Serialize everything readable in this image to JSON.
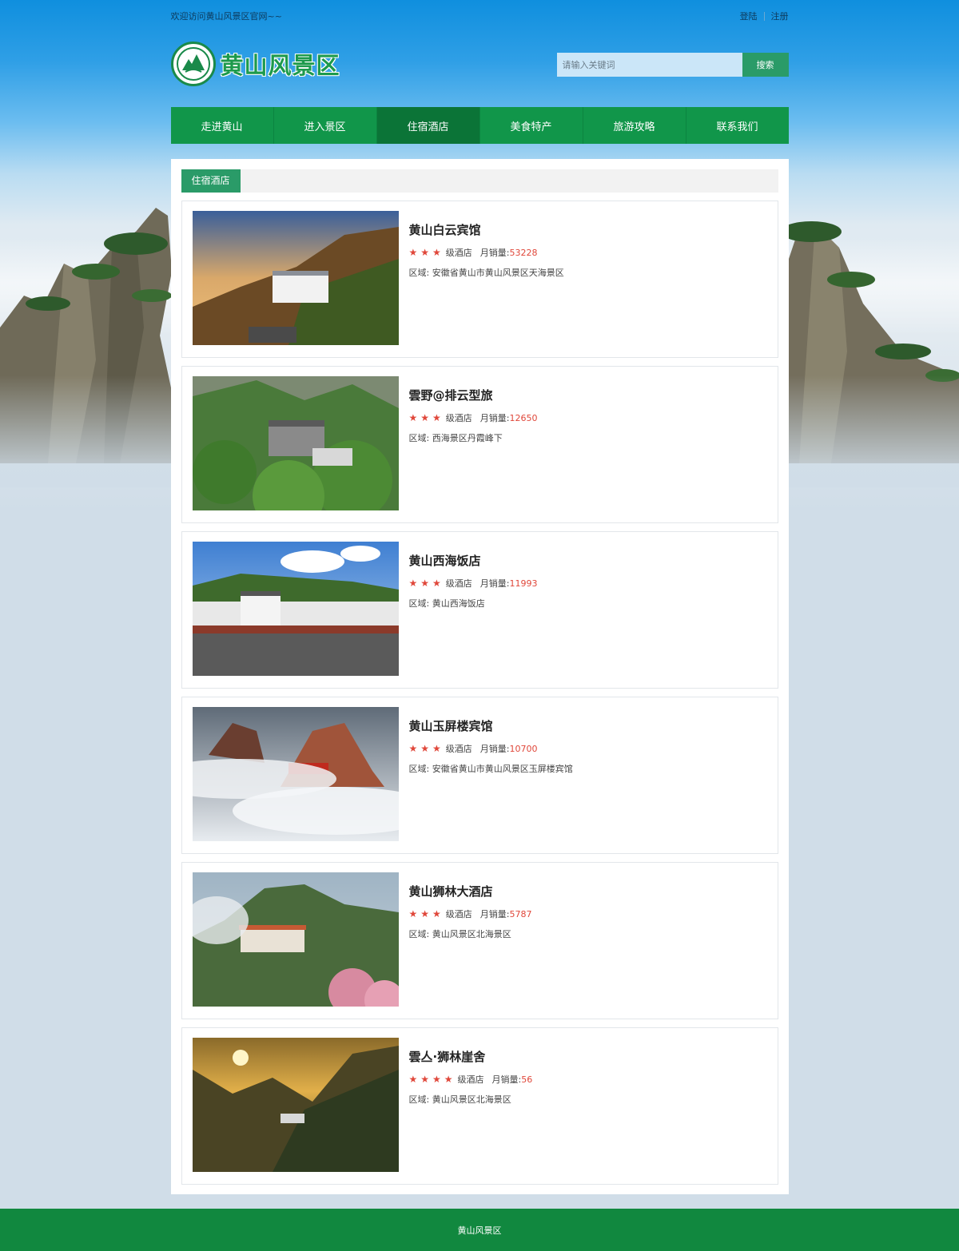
{
  "topbar": {
    "welcome": "欢迎访问黄山风景区官网~~",
    "login": "登陆",
    "register": "注册"
  },
  "header": {
    "logo_text": "黄山风景区",
    "search_placeholder": "请输入关键词",
    "search_button": "搜索"
  },
  "nav": [
    {
      "label": "走进黄山",
      "active": false
    },
    {
      "label": "进入景区",
      "active": false
    },
    {
      "label": "住宿酒店",
      "active": true
    },
    {
      "label": "美食特产",
      "active": false
    },
    {
      "label": "旅游攻略",
      "active": false
    },
    {
      "label": "联系我们",
      "active": false
    }
  ],
  "section": {
    "title": "住宿酒店"
  },
  "labels": {
    "level_suffix": "级酒店",
    "sales_label": "月销量:",
    "area_label": "区域:"
  },
  "hotels": [
    {
      "name": "黄山白云宾馆",
      "stars": "★★★",
      "sales": "53228",
      "area": "安徽省黄山市黄山风景区天海景区"
    },
    {
      "name": "雲野@排云型旅",
      "stars": "★★★",
      "sales": "12650",
      "area": "西海景区丹霞峰下"
    },
    {
      "name": "黄山西海饭店",
      "stars": "★★★",
      "sales": "11993",
      "area": "黄山西海饭店"
    },
    {
      "name": "黄山玉屏楼宾馆",
      "stars": "★★★",
      "sales": "10700",
      "area": "安徽省黄山市黄山风景区玉屏楼宾馆"
    },
    {
      "name": "黄山狮林大酒店",
      "stars": "★★★",
      "sales": "5787",
      "area": "黄山风景区北海景区"
    },
    {
      "name": "雲亼·狮林崖舍",
      "stars": "★★★★",
      "sales": "56",
      "area": "黄山风景区北海景区"
    }
  ],
  "footer": {
    "text": "黄山风景区"
  },
  "colors": {
    "nav_green": "#11964a",
    "accent_green": "#2a9b68",
    "price_red": "#e0473a"
  }
}
